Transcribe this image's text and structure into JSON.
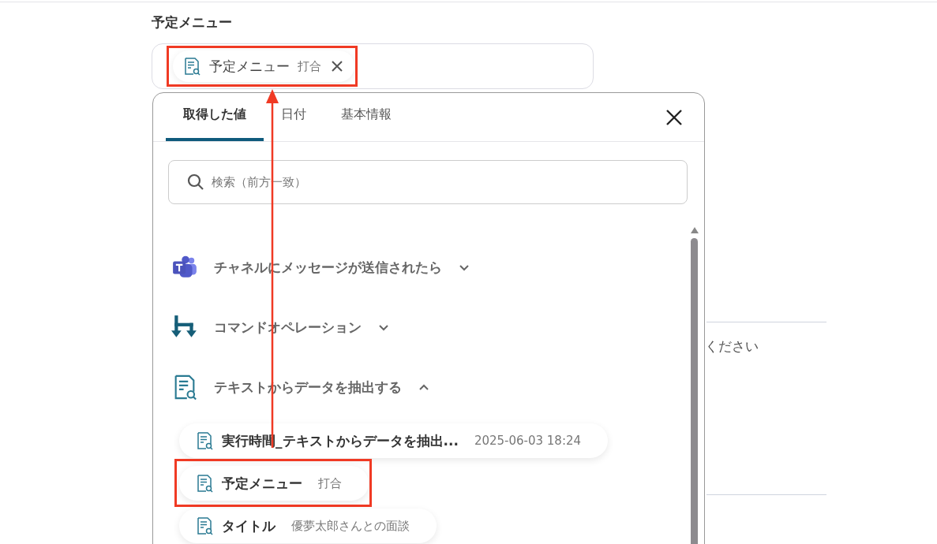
{
  "field": {
    "label": "予定メニュー",
    "chip": {
      "name": "予定メニュー",
      "value": "打合",
      "highlighted": true
    }
  },
  "background_text": "ください",
  "popup": {
    "tabs": [
      {
        "label": "取得した値",
        "selected": true
      },
      {
        "label": "日付",
        "selected": false
      },
      {
        "label": "基本情報",
        "selected": false
      }
    ],
    "search": {
      "placeholder": "検索（前方一致）"
    },
    "groups": [
      {
        "kind": "teams",
        "label": "チャネルにメッセージが送信されたら",
        "expanded": false
      },
      {
        "kind": "command",
        "label": "コマンドオペレーション",
        "expanded": false
      },
      {
        "kind": "extract",
        "label": "テキストからデータを抽出する",
        "expanded": true,
        "items": [
          {
            "name": "実行時間_テキストからデータを抽出...",
            "value": "2025-06-03 18:24",
            "highlighted": false
          },
          {
            "name": "予定メニュー",
            "value": "打合",
            "highlighted": true
          },
          {
            "name": "タイトル",
            "value": "優夢太郎さんとの面談",
            "highlighted": false
          }
        ]
      }
    ]
  }
}
